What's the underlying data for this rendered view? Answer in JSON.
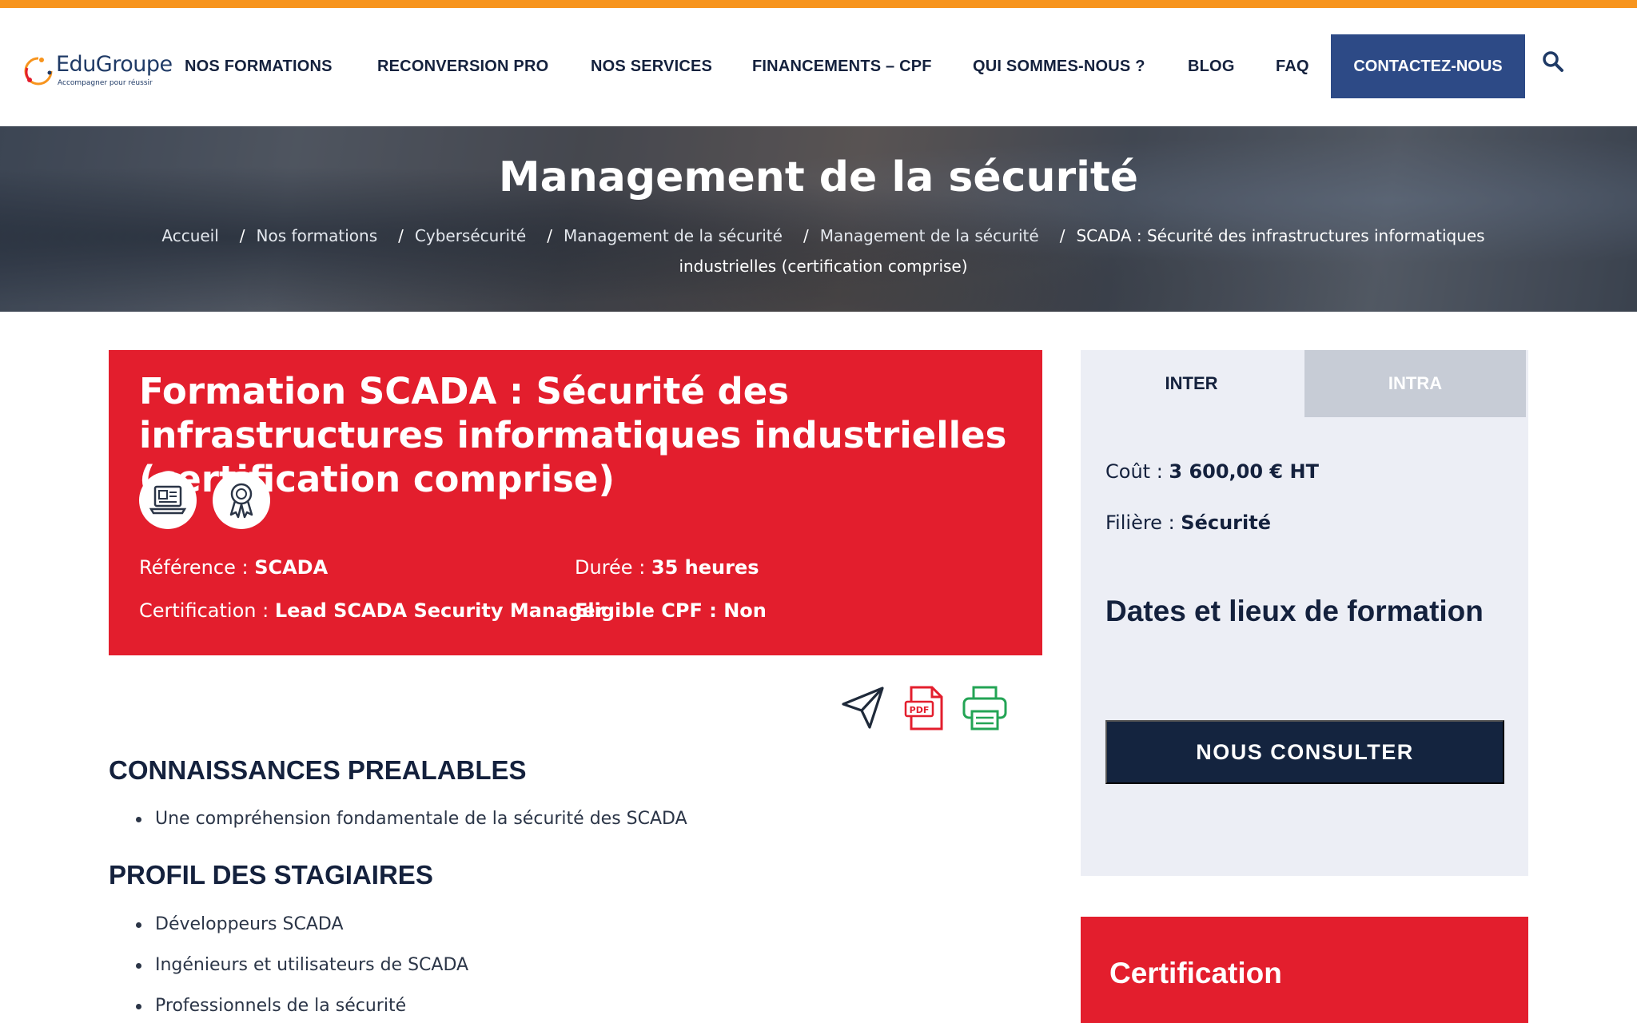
{
  "brand": {
    "name": "EduGroupe",
    "tagline": "Accompagner pour réussir",
    "colors": {
      "orange": "#f7941d",
      "navy": "#14243f",
      "blue": "#2d4a86",
      "red": "#e31e2d"
    }
  },
  "nav": {
    "items": [
      "NOS FORMATIONS",
      "RECONVERSION PRO",
      "NOS SERVICES",
      "FINANCEMENTS – CPF",
      "QUI SOMMES-NOUS ?",
      "BLOG",
      "FAQ"
    ],
    "cta": "CONTACTEZ-NOUS",
    "search_icon": "search-icon"
  },
  "hero": {
    "title": "Management de la sécurité",
    "breadcrumb": [
      "Accueil",
      "Nos formations",
      "Cybersécurité",
      "Management de la sécurité",
      "Management de la sécurité",
      "SCADA : Sécurité des infrastructures informatiques industrielles (certification comprise)"
    ]
  },
  "course": {
    "title": "Formation SCADA : Sécurité des infrastructures informatiques industrielles (certification comprise)",
    "badges": [
      "presentiel-distanciel-icon",
      "certification-ribbon-icon"
    ],
    "reference_label": "Référence : ",
    "reference_value": "SCADA",
    "duree_label": "Durée : ",
    "duree_value": "35 heures",
    "certification_label": "Certification : ",
    "certification_value": "Lead SCADA Security Manager",
    "cpf_label": "Eligible CPF : ",
    "cpf_value": "Non"
  },
  "actions": [
    "send-icon",
    "pdf-icon",
    "print-icon"
  ],
  "sections": {
    "prerequis_title": "CONNAISSANCES PREALABLES",
    "prerequis": [
      "Une compréhension fondamentale de la sécurité des SCADA"
    ],
    "profil_title": "PROFIL DES STAGIAIRES",
    "profil": [
      "Développeurs SCADA",
      "Ingénieurs et utilisateurs de SCADA",
      "Professionnels de la sécurité"
    ]
  },
  "sidebar": {
    "tabs": [
      "INTER",
      "INTRA"
    ],
    "cout_label": "Coût : ",
    "cout_value": "3 600,00 € HT",
    "filiere_label": "Filière : ",
    "filiere_value": "Sécurité",
    "dates_title": "Dates et lieux de formation",
    "consult_button": "NOUS CONSULTER",
    "certification_title": "Certification"
  }
}
